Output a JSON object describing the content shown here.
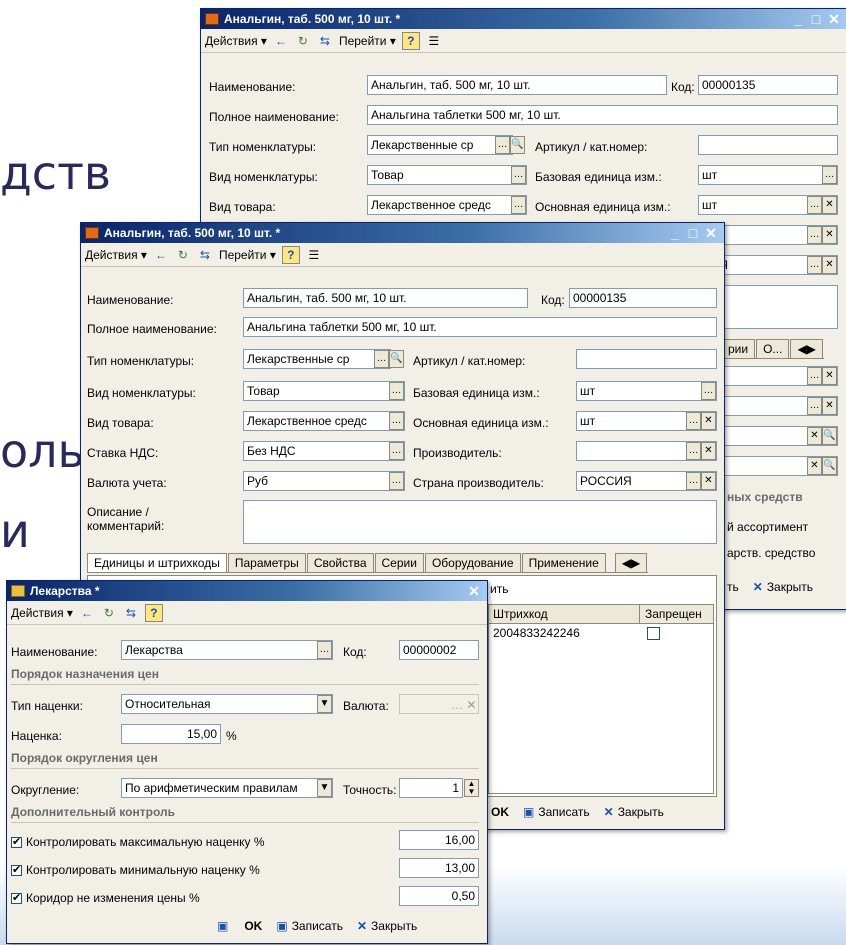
{
  "background": {
    "texts": [
      "дств",
      "оль",
      "и"
    ]
  },
  "win1": {
    "title": "Анальгин, таб. 500 мг, 10 шт. *",
    "toolbar": {
      "actions": "Действия ▾",
      "goto": "Перейти ▾",
      "help": "?"
    },
    "name_label": "Наименование:",
    "name_value": "Анальгин, таб. 500 мг, 10 шт.",
    "code_label": "Код:",
    "code_value": "00000135",
    "fullname_label": "Полное наименование:",
    "fullname_value": "Анальгина таблетки 500 мг, 10 шт.",
    "type_label": "Тип номенклатуры:",
    "type_value": "Лекарственные ср",
    "article_label": "Артикул / кат.номер:",
    "kind_label": "Вид номенклатуры:",
    "kind_value": "Товар",
    "base_unit_label": "Базовая единица изм.:",
    "base_unit_value": "шт",
    "goods_label": "Вид товара:",
    "goods_value": "Лекарственное средс",
    "main_unit_label": "Основная единица изм.:",
    "main_unit_value": "шт",
    "country_partial": "СИЯ",
    "tab_partial": [
      "рии",
      "О..."
    ],
    "right_partial": [
      "ных средств",
      "й ассортимент",
      "арств. средство"
    ],
    "bottom": {
      "write": "ть",
      "close": "Закрыть"
    }
  },
  "win2": {
    "title": "Анальгин, таб. 500 мг, 10 шт. *",
    "toolbar": {
      "actions": "Действия ▾",
      "goto": "Перейти ▾",
      "help": "?"
    },
    "name_label": "Наименование:",
    "name_value": "Анальгин, таб. 500 мг, 10 шт.",
    "code_label": "Код:",
    "code_value": "00000135",
    "fullname_label": "Полное наименование:",
    "fullname_value": "Анальгина таблетки 500 мг, 10 шт.",
    "type_label": "Тип номенклатуры:",
    "type_value": "Лекарственные ср",
    "article_label": "Артикул / кат.номер:",
    "kind_label": "Вид номенклатуры:",
    "kind_value": "Товар",
    "base_unit_label": "Базовая единица изм.:",
    "base_unit_value": "шт",
    "goods_label": "Вид товара:",
    "goods_value": "Лекарственное средс",
    "main_unit_label": "Основная единица изм.:",
    "main_unit_value": "шт",
    "vat_label": "Ставка НДС:",
    "vat_value": "Без НДС",
    "producer_label": "Производитель:",
    "currency_label": "Валюта учета:",
    "currency_value": "Руб",
    "country_label": "Страна производитель:",
    "country_value": "РОССИЯ",
    "desc_label": "Описание / комментарий:",
    "tabs": [
      "Единицы и штрихкоды",
      "Параметры",
      "Свойства",
      "Серии",
      "Оборудование",
      "Применение"
    ],
    "table_partial": "ить",
    "barcode_col": "Штрихкод",
    "banned_col": "Запрещен",
    "barcode_value": "2004833242246",
    "bottom": {
      "ok": "OK",
      "write": "Записать",
      "close": "Закрыть"
    }
  },
  "win3": {
    "title": "Лекарства *",
    "toolbar": {
      "actions": "Действия ▾",
      "help": "?"
    },
    "name_label": "Наименование:",
    "name_value": "Лекарства",
    "code_label": "Код:",
    "code_value": "00000002",
    "section1": "Порядок назначения цен",
    "markup_type_label": "Тип наценки:",
    "markup_type_value": "Относительная",
    "currency_label": "Валюта:",
    "markup_label": "Наценка:",
    "markup_value": "15,00",
    "markup_unit": "%",
    "section2": "Порядок округления цен",
    "rounding_label": "Округление:",
    "rounding_value": "По арифметическим правилам",
    "precision_label": "Точность:",
    "precision_value": "1",
    "section3": "Дополнительный контроль",
    "checks": [
      {
        "label": "Контролировать максимальную наценку %",
        "value": "16,00"
      },
      {
        "label": "Контролировать минимальную наценку %",
        "value": "13,00"
      },
      {
        "label": "Коридор не изменения цены %",
        "value": "0,50"
      }
    ],
    "bottom": {
      "ok": "OK",
      "write": "Записать",
      "close": "Закрыть"
    }
  }
}
